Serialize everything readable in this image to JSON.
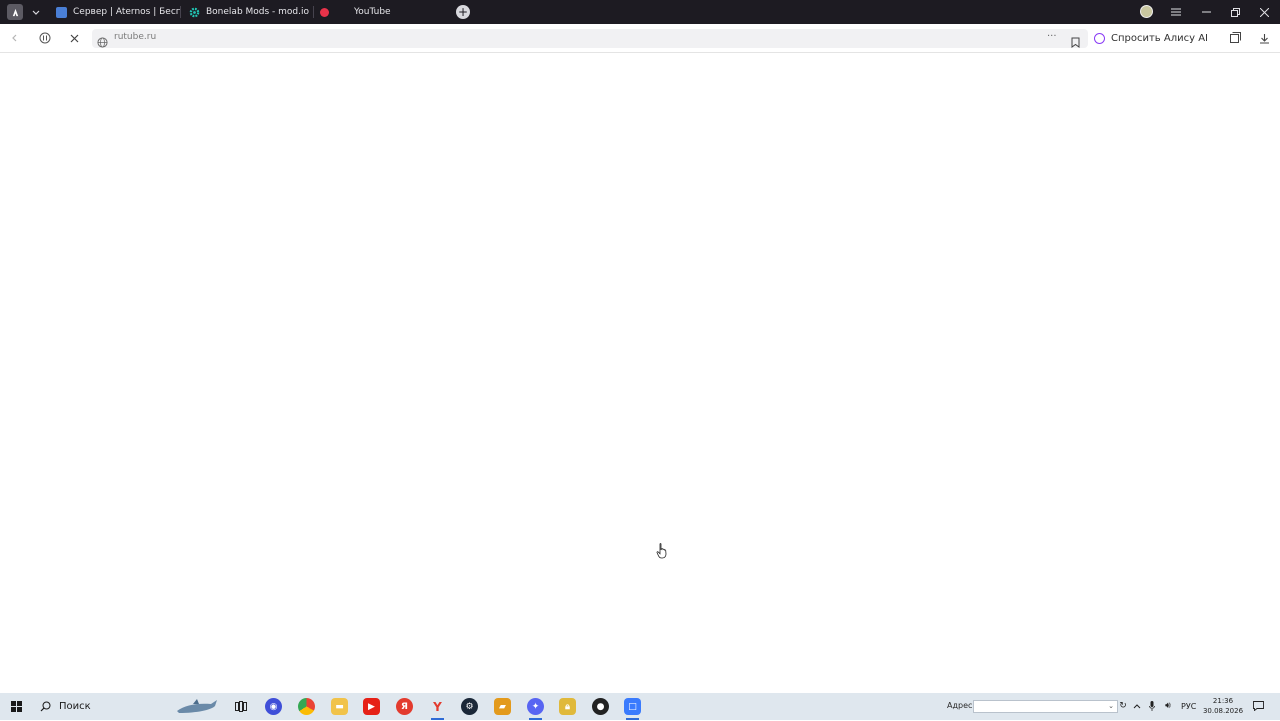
{
  "browser": {
    "tabs": [
      {
        "label": "Сервер | Aternos | Бесплатный",
        "color": "#4a7fd6"
      },
      {
        "label": "Bonelab Mods - mod.io",
        "color": "#21c7b5"
      },
      {
        "label": "",
        "color": "#e8334a"
      },
      {
        "label": "YouTube",
        "color": "#e62117"
      }
    ],
    "address": "rutube.ru",
    "alice_label": "Спросить Алису AI"
  },
  "icons": {
    "yandex_menu": "yandex-browser-icon",
    "back": "back-arrow-icon",
    "stop": "stop-loading-icon"
  },
  "taskbar": {
    "search_label": "Поиск",
    "address_label": "Адрес",
    "language": "РУС",
    "time": "21:36",
    "date": "30.08.2026"
  }
}
